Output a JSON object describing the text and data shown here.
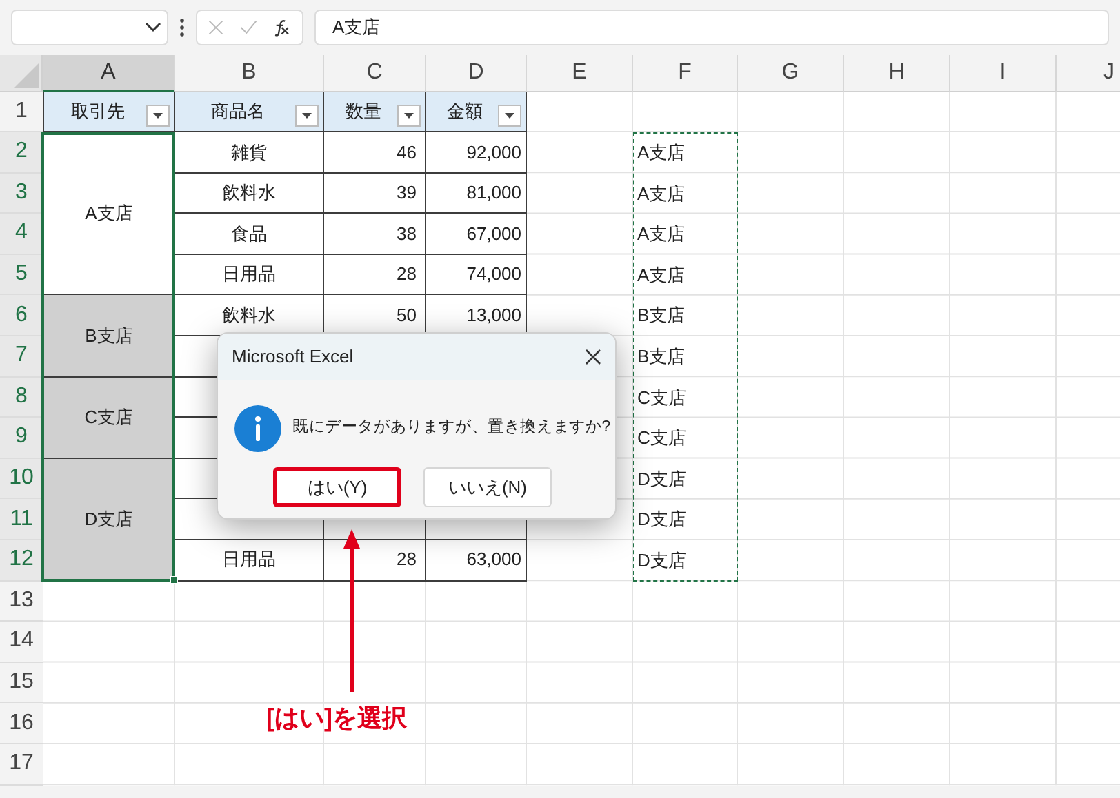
{
  "formula_bar": {
    "formula": "A支店"
  },
  "columns": [
    {
      "label": "A",
      "selected": true
    },
    {
      "label": "B",
      "selected": false
    },
    {
      "label": "C",
      "selected": false
    },
    {
      "label": "D",
      "selected": false
    },
    {
      "label": "E",
      "selected": false
    },
    {
      "label": "F",
      "selected": false
    },
    {
      "label": "G",
      "selected": false
    },
    {
      "label": "H",
      "selected": false
    },
    {
      "label": "I",
      "selected": false
    },
    {
      "label": "J",
      "selected": false
    }
  ],
  "rows": [
    {
      "label": "1",
      "selected": false
    },
    {
      "label": "2",
      "selected": true
    },
    {
      "label": "3",
      "selected": true
    },
    {
      "label": "4",
      "selected": true
    },
    {
      "label": "5",
      "selected": true
    },
    {
      "label": "6",
      "selected": true
    },
    {
      "label": "7",
      "selected": true
    },
    {
      "label": "8",
      "selected": true
    },
    {
      "label": "9",
      "selected": true
    },
    {
      "label": "10",
      "selected": true
    },
    {
      "label": "11",
      "selected": true
    },
    {
      "label": "12",
      "selected": true
    },
    {
      "label": "13",
      "selected": false
    },
    {
      "label": "14",
      "selected": false
    },
    {
      "label": "15",
      "selected": false
    },
    {
      "label": "16",
      "selected": false
    },
    {
      "label": "17",
      "selected": false
    }
  ],
  "table": {
    "headers": [
      "取引先",
      "商品名",
      "数量",
      "金額"
    ],
    "groups": [
      {
        "branch": "A支店",
        "shaded": false,
        "items": [
          {
            "product": "雑貨",
            "quantity": "46",
            "amount": "92,000"
          },
          {
            "product": "飲料水",
            "quantity": "39",
            "amount": "81,000"
          },
          {
            "product": "食品",
            "quantity": "38",
            "amount": "67,000"
          },
          {
            "product": "日用品",
            "quantity": "28",
            "amount": "74,000"
          }
        ]
      },
      {
        "branch": "B支店",
        "shaded": true,
        "items": [
          {
            "product": "飲料水",
            "quantity": "50",
            "amount": "13,000"
          },
          {
            "hidden": true
          }
        ]
      },
      {
        "branch": "C支店",
        "shaded": true,
        "items": [
          {
            "hidden": true
          },
          {
            "hidden": true
          }
        ]
      },
      {
        "branch": "D支店",
        "shaded": true,
        "items": [
          {
            "hidden": true
          },
          {
            "hidden": true
          },
          {
            "product": "日用品",
            "quantity": "28",
            "amount": "63,000"
          }
        ]
      }
    ]
  },
  "copied_column": [
    "A支店",
    "A支店",
    "A支店",
    "A支店",
    "B支店",
    "B支店",
    "C支店",
    "C支店",
    "D支店",
    "D支店",
    "D支店"
  ],
  "dialog": {
    "title": "Microsoft Excel",
    "message": "既にデータがありますが、置き換えますか?",
    "buttons": [
      {
        "label": "はい(Y)",
        "highlighted": true
      },
      {
        "label": "いいえ(N)",
        "highlighted": false
      }
    ]
  },
  "annotation": {
    "text": "[はい]を選択"
  }
}
